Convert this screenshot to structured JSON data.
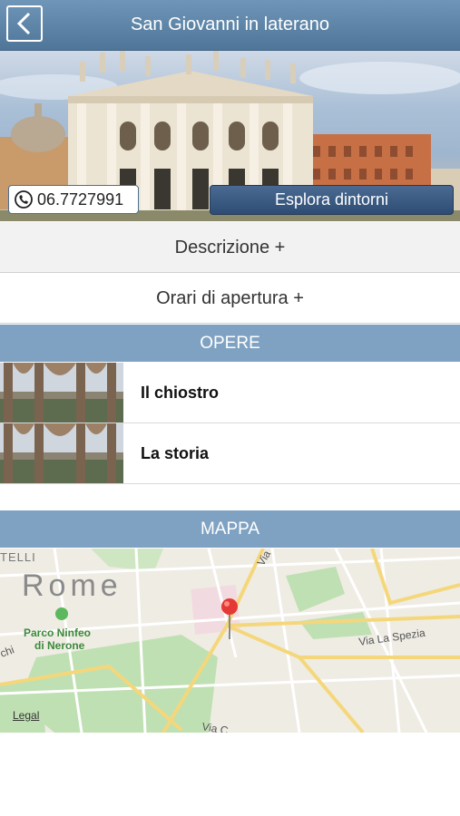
{
  "navbar": {
    "title": "San Giovanni in laterano",
    "back_icon": "chevron-left-icon"
  },
  "hero": {
    "phone_icon": "phone-icon",
    "phone_number": "06.7727991",
    "explore_label": "Esplora dintorni"
  },
  "rows": {
    "description": "Descrizione +",
    "opening_hours": "Orari di apertura +"
  },
  "opere": {
    "header": "OPERE",
    "items": [
      {
        "title": "Il chiostro"
      },
      {
        "title": "La storia"
      }
    ]
  },
  "mappa": {
    "header": "MAPPA",
    "labels": {
      "city": "Rome",
      "park_line1": "Parco Ninfeo",
      "park_line2": "di Nerone",
      "street_spezia": "Via La Spezia",
      "street_top": "Via",
      "street_bottom": "Via C",
      "street_left": "chi",
      "district_fragment": "TELLI",
      "legal": "Legal"
    }
  },
  "colors": {
    "navbar": "#5b82a5",
    "section_header": "#7fa2c2",
    "button": "#38587f",
    "pin": "#e53935"
  }
}
